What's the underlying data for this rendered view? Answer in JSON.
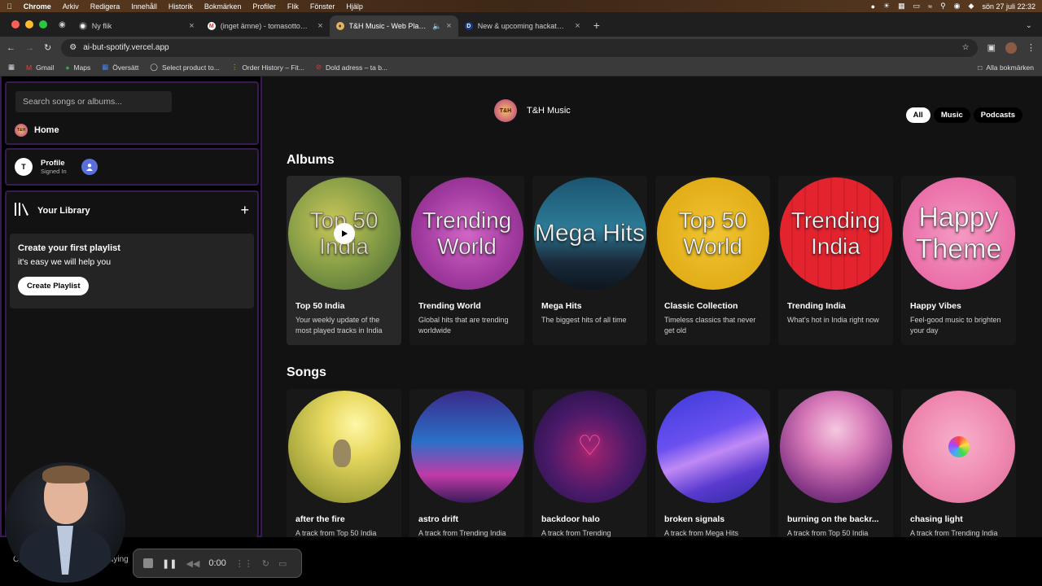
{
  "menubar": {
    "items": [
      "Chrome",
      "Arkiv",
      "Redigera",
      "Innehåll",
      "Historik",
      "Bokmärken",
      "Profiler",
      "Flik",
      "Fönster",
      "Hjälp"
    ],
    "datetime": "sön 27 juli  22:32"
  },
  "tabs": [
    {
      "title": "Ny flik"
    },
    {
      "title": "(inget ämne) - tomasottosson"
    },
    {
      "title": "T&H Music - Web Player"
    },
    {
      "title": "New & upcoming hackathons"
    }
  ],
  "address": {
    "url": "ai-but-spotify.vercel.app"
  },
  "bookmarks": {
    "items": [
      "Gmail",
      "Maps",
      "Översätt",
      "Select product to...",
      "Order History – Fit...",
      "Dold adress – ta b..."
    ],
    "all": "Alla bokmärken"
  },
  "sidebar": {
    "search_placeholder": "Search songs or albums...",
    "home_label": "Home",
    "logo_text": "T&H",
    "profile": {
      "initial": "T",
      "name": "Profile",
      "status": "Signed In"
    },
    "library_label": "Your Library",
    "create": {
      "heading": "Create your first playlist",
      "sub": "it's easy we will help you",
      "button": "Create Playlist"
    }
  },
  "header": {
    "brand": "T&H Music",
    "logo_text": "T&H",
    "filters": [
      "All",
      "Music",
      "Podcasts"
    ],
    "active_filter": "All"
  },
  "albums_heading": "Albums",
  "albums": [
    {
      "cover": "Top 50\nIndia",
      "title": "Top 50 India",
      "desc": "Your weekly update of the most played tracks in India"
    },
    {
      "cover": "Trending\nWorld",
      "title": "Trending World",
      "desc": "Global hits that are trending worldwide"
    },
    {
      "cover": "Mega Hits",
      "title": "Mega Hits",
      "desc": "The biggest hits of all time"
    },
    {
      "cover": "Top 50\nWorld",
      "title": "Classic Collection",
      "desc": "Timeless classics that never get old"
    },
    {
      "cover": "Trending\nIndia",
      "title": "Trending India",
      "desc": "What's hot in India right now"
    },
    {
      "cover": "Happy\nTheme",
      "title": "Happy Vibes",
      "desc": "Feel-good music to brighten your day"
    }
  ],
  "songs_heading": "Songs",
  "songs": [
    {
      "title": "after the fire",
      "desc": "A track from Top 50 India"
    },
    {
      "title": "astro drift",
      "desc": "A track from Trending India"
    },
    {
      "title": "backdoor halo",
      "desc": "A track from Trending"
    },
    {
      "title": "broken signals",
      "desc": "A track from Mega Hits"
    },
    {
      "title": "burning on the backr...",
      "desc": "A track from Top 50 India"
    },
    {
      "title": "chasing light",
      "desc": "A track from Trending India"
    }
  ],
  "player": {
    "left_text": "C",
    "playing_text": "playing"
  },
  "recorder": {
    "time": "0:00"
  }
}
